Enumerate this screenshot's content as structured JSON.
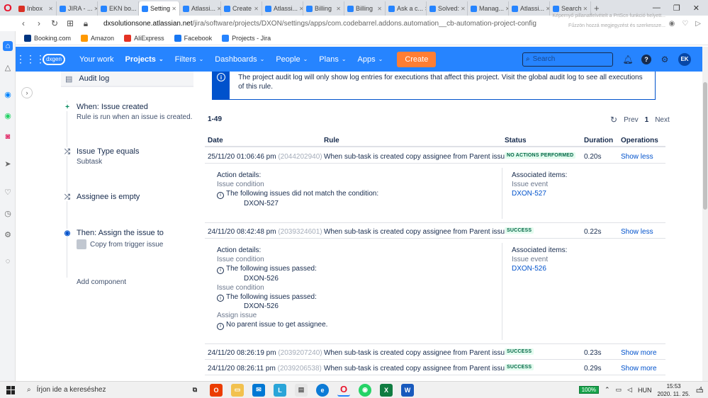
{
  "browser": {
    "tabs": [
      {
        "label": "Inbox",
        "color": "#d93025",
        "active": false
      },
      {
        "label": "JIRA - ...",
        "color": "#2684ff",
        "active": false
      },
      {
        "label": "EKN bo...",
        "color": "#2684ff",
        "active": false
      },
      {
        "label": "Setting",
        "color": "#2684ff",
        "active": true
      },
      {
        "label": "Atlassi...",
        "color": "#2684ff",
        "active": false
      },
      {
        "label": "Create",
        "color": "#2684ff",
        "active": false
      },
      {
        "label": "Atlassi...",
        "color": "#2684ff",
        "active": false
      },
      {
        "label": "Billing",
        "color": "#2684ff",
        "active": false
      },
      {
        "label": "Billing",
        "color": "#2684ff",
        "active": false
      },
      {
        "label": "Ask a c...",
        "color": "#2684ff",
        "active": false
      },
      {
        "label": "Solved:",
        "color": "#2684ff",
        "active": false
      },
      {
        "label": "Manag...",
        "color": "#2684ff",
        "active": false
      },
      {
        "label": "Atlassi...",
        "color": "#2684ff",
        "active": false
      },
      {
        "label": "Search",
        "color": "#2684ff",
        "active": false
      }
    ],
    "url_host": "dxsolutionsone.atlassian.net",
    "url_path": "/jira/software/projects/DXON/settings/apps/com.codebarrel.addons.automation__cb-automation-project-config",
    "prtsc_line1": "Képernyő pillanatfelvételt a PrtScn funkció helyett...",
    "prtsc_line2": "Fűzzön hozzá megjegyzést és szerkessze...",
    "bookmarks": [
      {
        "label": "Booking.com",
        "color": "#003580"
      },
      {
        "label": "Amazon",
        "color": "#ff9900"
      },
      {
        "label": "AliExpress",
        "color": "#e43225"
      },
      {
        "label": "Facebook",
        "color": "#1877f2"
      },
      {
        "label": "Projects - Jira",
        "color": "#2684ff"
      }
    ]
  },
  "jira_nav": {
    "items": [
      "Your work",
      "Projects",
      "Filters",
      "Dashboards",
      "People",
      "Plans",
      "Apps"
    ],
    "logo_text": "dxgen",
    "create_label": "Create",
    "search_placeholder": "Search",
    "avatar_initials": "EK"
  },
  "rule_panel": {
    "audit_log_label": "Audit log",
    "steps": [
      {
        "title": "When: Issue created",
        "subtitle": "Rule is run when an issue is created."
      },
      {
        "title": "Issue Type equals",
        "subtitle": "Subtask"
      },
      {
        "title": "Assignee is empty",
        "subtitle": ""
      },
      {
        "title": "Then: Assign the issue to",
        "subtitle": "Copy from trigger issue"
      }
    ],
    "add_component": "Add component"
  },
  "info_message": "The project audit log will only show log entries for executions that affect this project. Visit the global audit log to see all executions of this rule.",
  "results_range": "1-49",
  "pager": {
    "prev": "Prev",
    "page": "1",
    "next": "Next"
  },
  "table": {
    "headers": {
      "date": "Date",
      "rule": "Rule",
      "status": "Status",
      "duration": "Duration",
      "operations": "Operations"
    },
    "rows": [
      {
        "date": "25/11/20 01:06:46 pm",
        "id": "(2044202940)",
        "rule": "When sub-task is created copy assignee from Parent issue",
        "status": "NO ACTIONS PERFORMED",
        "duration": "0.20s",
        "op": "Show less"
      },
      {
        "date": "24/11/20 08:42:48 pm",
        "id": "(2039324601)",
        "rule": "When sub-task is created copy assignee from Parent issue",
        "status": "SUCCESS",
        "duration": "0.22s",
        "op": "Show less"
      },
      {
        "date": "24/11/20 08:26:19 pm",
        "id": "(2039207240)",
        "rule": "When sub-task is created copy assignee from Parent issue",
        "status": "SUCCESS",
        "duration": "0.23s",
        "op": "Show more"
      },
      {
        "date": "24/11/20 08:26:11 pm",
        "id": "(2039206538)",
        "rule": "When sub-task is created copy assignee from Parent issue",
        "status": "SUCCESS",
        "duration": "0.29s",
        "op": "Show more"
      }
    ]
  },
  "details": [
    {
      "action_label": "Action details:",
      "lines": [
        {
          "kind": "grey",
          "text": "Issue condition"
        },
        {
          "kind": "clock",
          "text": "The following issues did not match the condition:"
        },
        {
          "kind": "indent",
          "text": "DXON-527"
        }
      ],
      "assoc_label": "Associated items:",
      "assoc_type": "Issue event",
      "assoc_key": "DXON-527"
    },
    {
      "action_label": "Action details:",
      "lines": [
        {
          "kind": "grey",
          "text": "Issue condition"
        },
        {
          "kind": "clock",
          "text": "The following issues passed:"
        },
        {
          "kind": "indent",
          "text": "DXON-526"
        },
        {
          "kind": "grey",
          "text": "Issue condition"
        },
        {
          "kind": "clock",
          "text": "The following issues passed:"
        },
        {
          "kind": "indent",
          "text": "DXON-526"
        },
        {
          "kind": "grey",
          "text": "Assign issue"
        },
        {
          "kind": "clock",
          "text": "No parent issue to get assignee."
        }
      ],
      "assoc_label": "Associated items:",
      "assoc_type": "Issue event",
      "assoc_key": "DXON-526"
    }
  ],
  "taskbar": {
    "search_placeholder": "Írjon ide a kereséshez",
    "battery": "100%",
    "language": "HUN",
    "time": "15:53",
    "date": "2020. 11. 25.",
    "notifications": "4"
  }
}
